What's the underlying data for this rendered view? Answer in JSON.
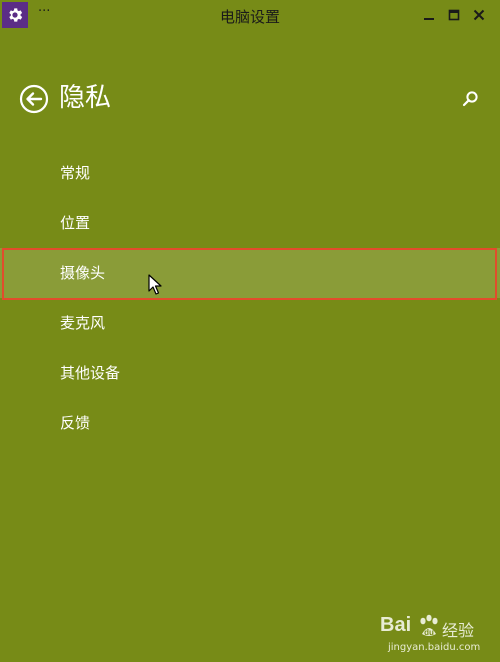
{
  "window": {
    "title": "电脑设置",
    "menu_label": "···"
  },
  "header": {
    "title": "隐私",
    "back_icon": "back-arrow-circle-icon",
    "search_icon": "search-icon"
  },
  "nav": {
    "items": [
      {
        "label": "常规",
        "selected": false
      },
      {
        "label": "位置",
        "selected": false
      },
      {
        "label": "摄像头",
        "selected": true
      },
      {
        "label": "麦克风",
        "selected": false
      },
      {
        "label": "其他设备",
        "selected": false
      },
      {
        "label": "反馈",
        "selected": false
      }
    ]
  },
  "watermark": {
    "brand": "Bai",
    "brand_cn": "经验",
    "url": "jingyan.baidu.com"
  },
  "colors": {
    "background": "#778b17",
    "selected_item": "#8a9c38",
    "highlight_border": "#e24c2c",
    "app_icon_bg": "#5b2d86"
  }
}
